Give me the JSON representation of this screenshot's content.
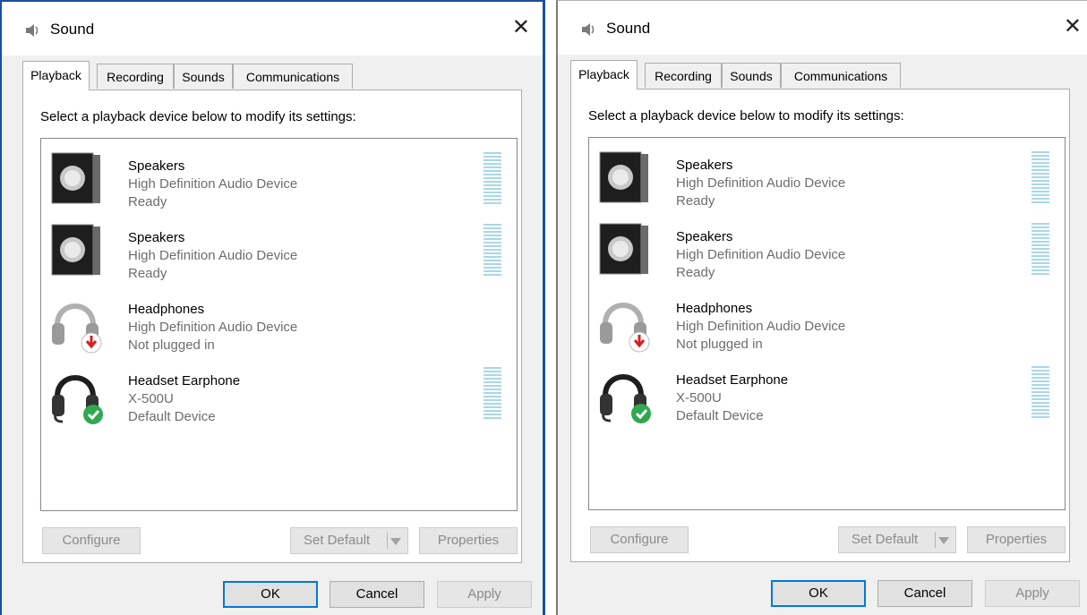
{
  "dialogs": [
    {
      "title": "Sound",
      "tabs": [
        "Playback",
        "Recording",
        "Sounds",
        "Communications"
      ],
      "active_tab": "Playback",
      "instruction": "Select a playback device below to modify its settings:",
      "devices": [
        {
          "name": "Speakers",
          "description": "High Definition Audio Device",
          "status": "Ready",
          "icon": "speaker-icon",
          "has_level_meter": true
        },
        {
          "name": "Speakers",
          "description": "High Definition Audio Device",
          "status": "Ready",
          "icon": "speaker-icon",
          "has_level_meter": true
        },
        {
          "name": "Headphones",
          "description": "High Definition Audio Device",
          "status": "Not plugged in",
          "icon": "headphones-unplugged-icon",
          "has_level_meter": false
        },
        {
          "name": "Headset Earphone",
          "description": "X-500U",
          "status": "Default Device",
          "icon": "headset-default-icon",
          "has_level_meter": true
        }
      ],
      "buttons": {
        "configure": "Configure",
        "set_default": "Set Default",
        "properties": "Properties",
        "ok": "OK",
        "cancel": "Cancel",
        "apply": "Apply"
      }
    },
    {
      "title": "Sound",
      "tabs": [
        "Playback",
        "Recording",
        "Sounds",
        "Communications"
      ],
      "active_tab": "Playback",
      "instruction": "Select a playback device below to modify its settings:",
      "devices": [
        {
          "name": "Speakers",
          "description": "High Definition Audio Device",
          "status": "Ready",
          "icon": "speaker-icon",
          "has_level_meter": true
        },
        {
          "name": "Speakers",
          "description": "High Definition Audio Device",
          "status": "Ready",
          "icon": "speaker-icon",
          "has_level_meter": true
        },
        {
          "name": "Headphones",
          "description": "High Definition Audio Device",
          "status": "Not plugged in",
          "icon": "headphones-unplugged-icon",
          "has_level_meter": false
        },
        {
          "name": "Headset Earphone",
          "description": "X-500U",
          "status": "Default Device",
          "icon": "headset-default-icon",
          "has_level_meter": true
        }
      ],
      "buttons": {
        "configure": "Configure",
        "set_default": "Set Default",
        "properties": "Properties",
        "ok": "OK",
        "cancel": "Cancel",
        "apply": "Apply"
      }
    }
  ],
  "colors": {
    "accent": "#0078d7",
    "meter": "#a8d8e8",
    "default_badge": "#2fa84f",
    "unplugged_badge": "#d42020"
  }
}
